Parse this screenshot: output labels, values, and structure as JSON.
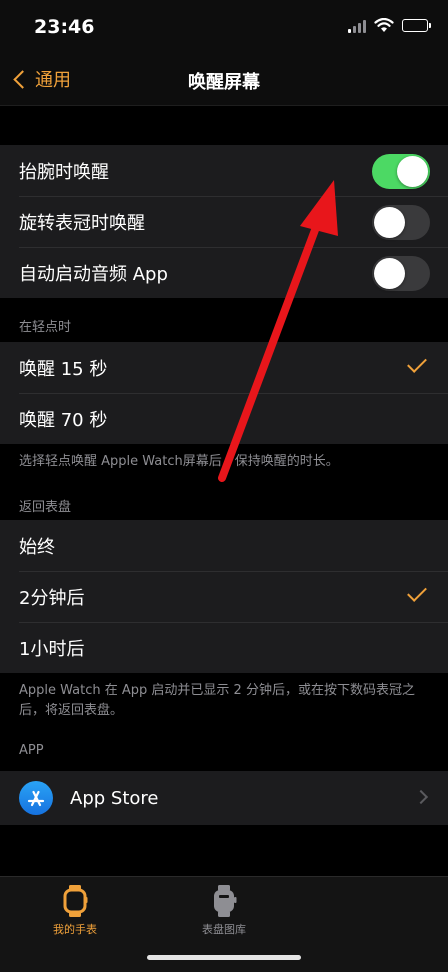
{
  "status": {
    "time": "23:46"
  },
  "nav": {
    "back_label": "通用",
    "title": "唤醒屏幕"
  },
  "toggles": [
    {
      "label": "抬腕时唤醒",
      "on": true
    },
    {
      "label": "旋转表冠时唤醒",
      "on": false
    },
    {
      "label": "自动启动音频 App",
      "on": false
    }
  ],
  "tap_section": {
    "header": "在轻点时",
    "options": [
      {
        "label": "唤醒 15 秒",
        "selected": true
      },
      {
        "label": "唤醒 70 秒",
        "selected": false
      }
    ],
    "footer": "选择轻点唤醒 Apple Watch屏幕后，保持唤醒的时长。"
  },
  "return_section": {
    "header": "返回表盘",
    "options": [
      {
        "label": "始终",
        "selected": false
      },
      {
        "label": "2分钟后",
        "selected": true
      },
      {
        "label": "1小时后",
        "selected": false
      }
    ],
    "footer": "Apple Watch 在 App 启动并已显示 2 分钟后，或在按下数码表冠之后，将返回表盘。"
  },
  "app_section": {
    "header": "APP",
    "apps": [
      {
        "label": "App Store",
        "icon": "app-store-icon"
      }
    ]
  },
  "tabs": [
    {
      "label": "我的手表",
      "icon": "watch-icon",
      "active": true
    },
    {
      "label": "表盘图库",
      "icon": "watch-face-gallery-icon",
      "active": false
    }
  ],
  "colors": {
    "accent": "#f0a13a",
    "toggle_on": "#4cd964",
    "annotation_arrow": "#e8161b"
  }
}
